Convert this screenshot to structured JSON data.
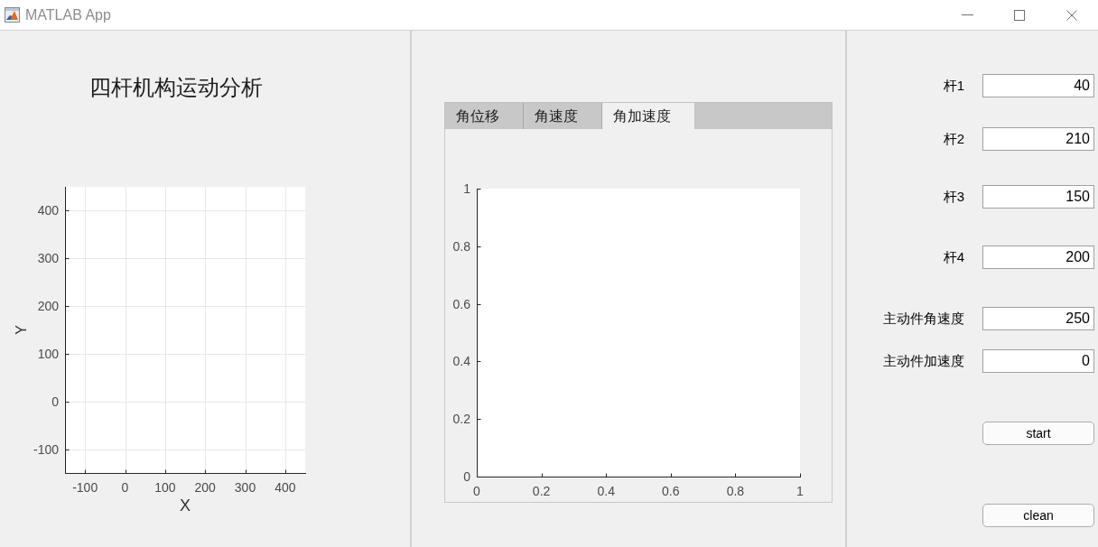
{
  "window": {
    "title": "MATLAB App"
  },
  "left_panel": {
    "heading": "四杆机构运动分析",
    "chart_data": {
      "type": "line",
      "xlabel": "X",
      "ylabel": "Y",
      "xlim": [
        -150,
        450
      ],
      "ylim": [
        -150,
        450
      ],
      "xticks": [
        -100,
        0,
        100,
        200,
        300,
        400
      ],
      "yticks": [
        -100,
        0,
        100,
        200,
        300,
        400
      ],
      "grid": true
    }
  },
  "tab_group": {
    "tabs": [
      {
        "label": "角位移",
        "selected": false
      },
      {
        "label": "角速度",
        "selected": false
      },
      {
        "label": "角加速度",
        "selected": true
      }
    ],
    "chart_data": {
      "type": "line",
      "xlim": [
        0,
        1
      ],
      "ylim": [
        0,
        1
      ],
      "xticks": [
        0,
        0.2,
        0.4,
        0.6,
        0.8,
        1
      ],
      "yticks": [
        0,
        0.2,
        0.4,
        0.6,
        0.8,
        1
      ]
    }
  },
  "parameters": [
    {
      "label": "杆1",
      "value": "40"
    },
    {
      "label": "杆2",
      "value": "210"
    },
    {
      "label": "杆3",
      "value": "150"
    },
    {
      "label": "杆4",
      "value": "200"
    },
    {
      "label": "主动件角速度",
      "value": "250"
    },
    {
      "label": "主动件加速度",
      "value": "0"
    }
  ],
  "buttons": [
    "start",
    "clean"
  ]
}
